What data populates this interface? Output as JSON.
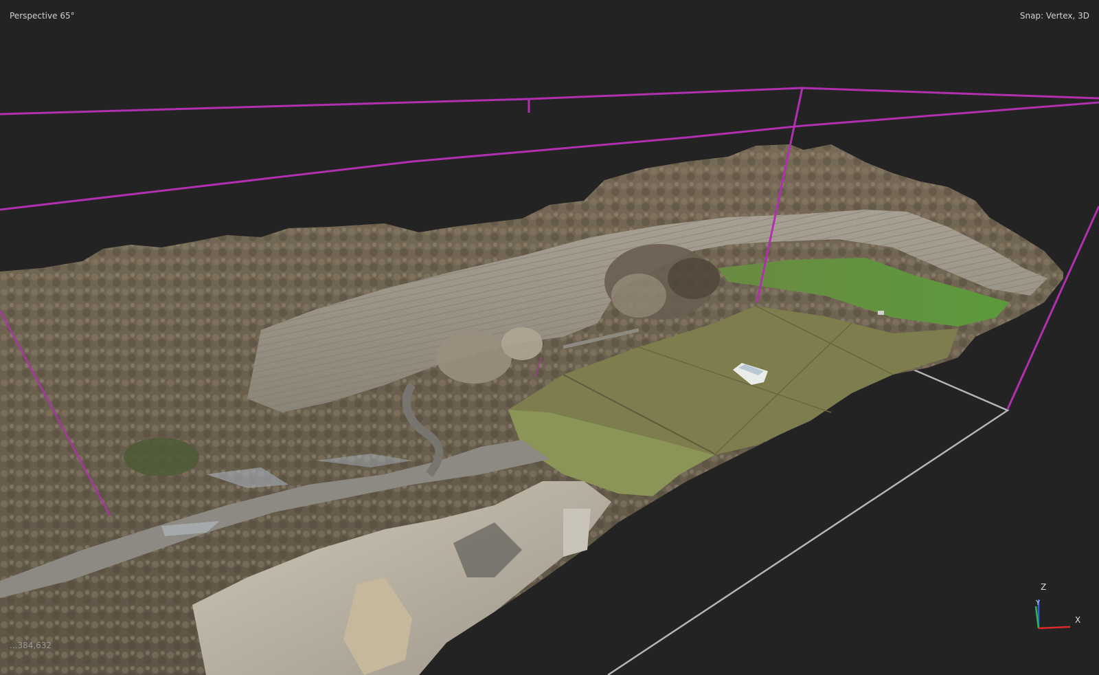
{
  "viewport": {
    "projection_label": "Perspective 65°",
    "snap_label": "Snap: Vertex, 3D",
    "coordinate_readout": "...384,632"
  },
  "axis_gizmo": {
    "z_label": "Z",
    "y_label": "Y",
    "x_label": "X",
    "z_color": "#2f5fe0",
    "y_color": "#2fb84a",
    "x_color": "#e02a2a"
  },
  "colors": {
    "background": "#232323",
    "region_box": "#b030b0",
    "ground_plane": "#b5b5b5",
    "hud_text": "#d2d2d2"
  },
  "scene": {
    "model_icon": "textured-mesh-icon",
    "content": "photogrammetry quarry mesh"
  }
}
